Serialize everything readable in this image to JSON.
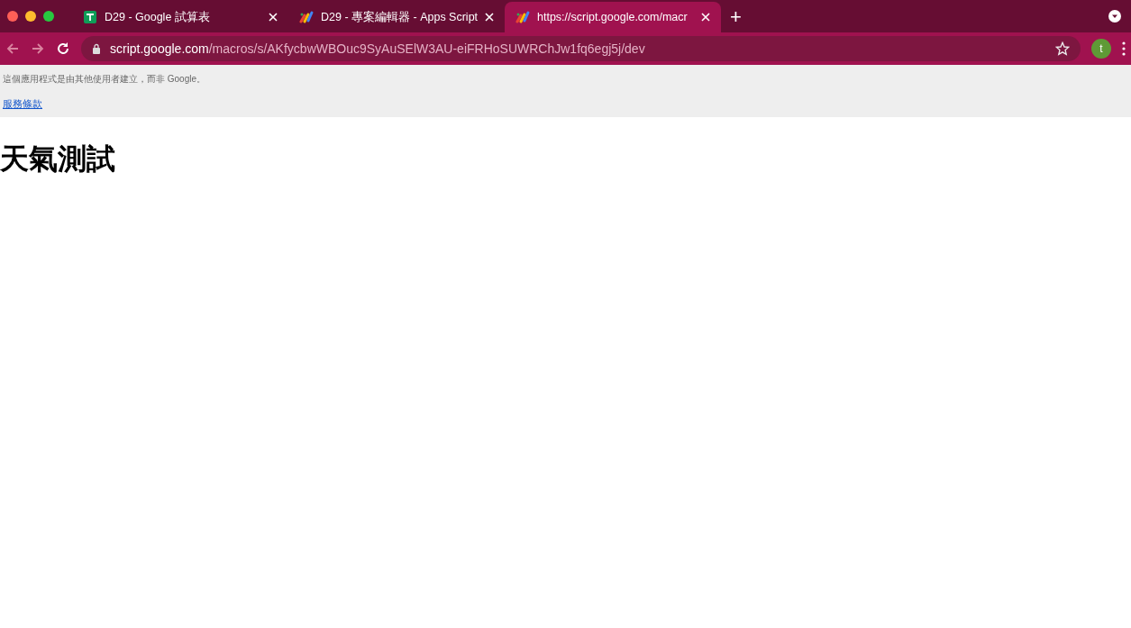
{
  "tabs": [
    {
      "title": "D29 - Google 試算表",
      "kind": "sheets",
      "selected": false
    },
    {
      "title": "D29 - 專案編輯器 - Apps Script",
      "kind": "script",
      "selected": false
    },
    {
      "title": "https://script.google.com/macr",
      "kind": "script",
      "selected": true
    }
  ],
  "new_tab": "+",
  "address_bar": {
    "host": "script.google.com",
    "path": "/macros/s/AKfycbwWBOuc9SyAuSElW3AU-eiFRHoSUWRChJw1fq6egj5j/dev"
  },
  "profile": {
    "initial": "t"
  },
  "banner": {
    "notice": "這個應用程式是由其他使用者建立，而非 Google。",
    "link": "服務條款"
  },
  "page": {
    "heading": "天氣測試"
  }
}
